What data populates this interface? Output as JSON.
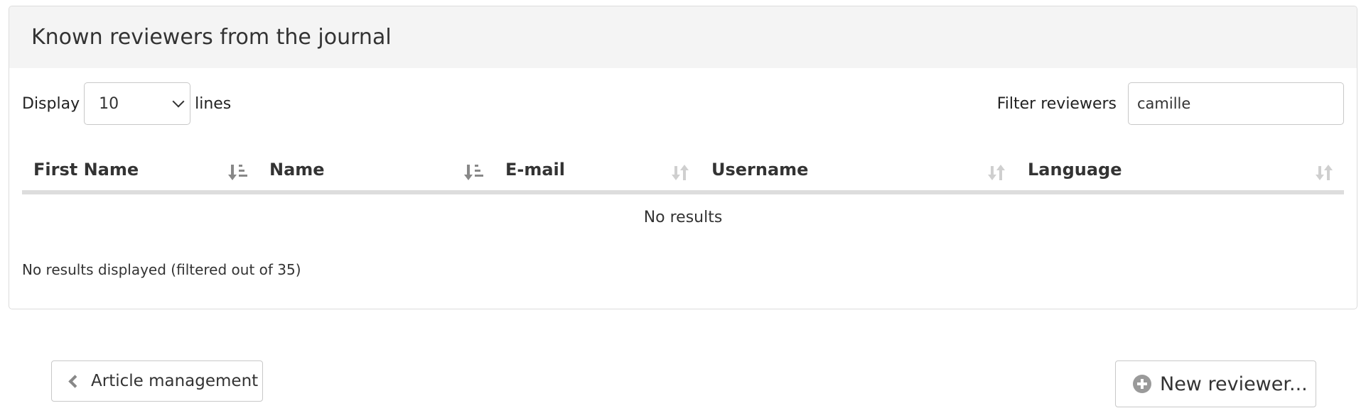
{
  "panel": {
    "title": "Known reviewers from the journal"
  },
  "length": {
    "prefix": "Display",
    "selected": "10",
    "suffix": "lines"
  },
  "filter": {
    "label": "Filter reviewers",
    "value": "camille"
  },
  "table": {
    "columns": [
      {
        "label": "First Name",
        "sort_icon": "sort-alpha-asc-icon",
        "sort_active": true
      },
      {
        "label": "Name",
        "sort_icon": "sort-alpha-asc-icon",
        "sort_active": true
      },
      {
        "label": "E-mail",
        "sort_icon": "sort-both-icon",
        "sort_active": false
      },
      {
        "label": "Username",
        "sort_icon": "sort-both-icon",
        "sort_active": false
      },
      {
        "label": "Language",
        "sort_icon": "sort-both-icon",
        "sort_active": false
      }
    ],
    "empty_text": "No results",
    "info_text": "No results displayed (filtered out of 35)"
  },
  "buttons": {
    "back_label": "Article management",
    "new_label": "New reviewer..."
  },
  "colors": {
    "heading_bg": "#f4f4f4",
    "border": "#dcdcdc",
    "icon_gray": "#9a9a9a"
  }
}
